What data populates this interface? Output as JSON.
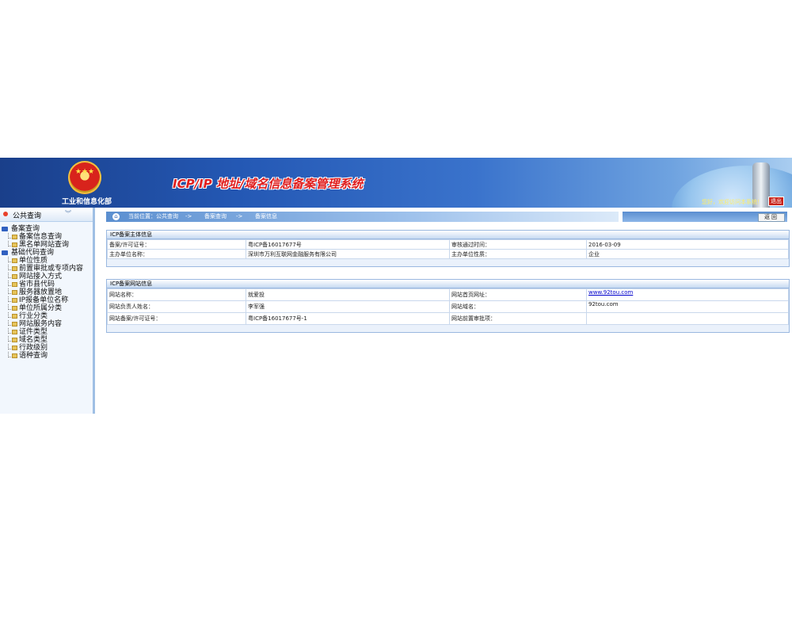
{
  "header": {
    "ministry": "工业和信息化部",
    "system_title": "ICP/IP 地址/域名信息备案管理系统",
    "welcome": "您好，欢迎访问本系统！",
    "logout_label": "退出"
  },
  "sidebar": {
    "section_title": "公共查询",
    "groups": [
      {
        "label": "备案查询",
        "items": [
          "备案信息查询",
          "黑名单网站查询"
        ]
      },
      {
        "label": "基础代码查询",
        "items": [
          "单位性质",
          "前置审批或专项内容",
          "网站接入方式",
          "省市县代码",
          "服务器放置地",
          "IP报备单位名称",
          "单位所属分类",
          "行业分类",
          "网站服务内容",
          "证件类型",
          "域名类型",
          "行政级别",
          "语种查询"
        ]
      }
    ]
  },
  "breadcrumb": {
    "prefix": "当前位置：公共查询",
    "sep": "->",
    "level2": "备案查询",
    "level3": "备案信息"
  },
  "back_label": "返回",
  "main_panel": {
    "title": "ICP备案主体信息",
    "rows": [
      [
        "备案/许可证号：",
        "粤ICP备16017677号",
        "审核通过时间：",
        "2016-03-09"
      ],
      [
        "主办单位名称：",
        "深圳市万利互联网金融服务有限公司",
        "主办单位性质：",
        "企业"
      ]
    ]
  },
  "site_panel": {
    "title": "ICP备案网站信息",
    "rows": [
      [
        "网站名称：",
        "就爱投",
        "网站首页网址：",
        "www.92tou.com"
      ],
      [
        "网站负责人姓名：",
        "李军强",
        "网站域名：",
        "92tou.com"
      ],
      [
        "网站备案/许可证号：",
        "粤ICP备16017677号-1",
        "网站前置审批项：",
        ""
      ]
    ]
  }
}
